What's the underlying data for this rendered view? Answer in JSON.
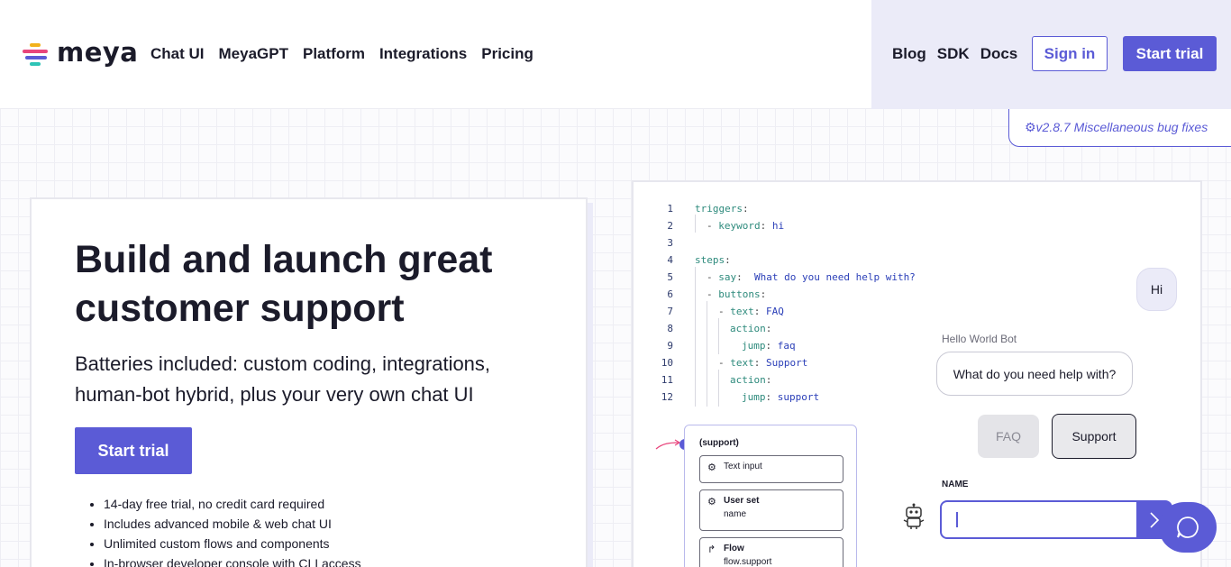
{
  "header": {
    "logo_text": "meya",
    "nav": [
      "Chat UI",
      "MeyaGPT",
      "Platform",
      "Integrations",
      "Pricing"
    ],
    "nav_right": [
      "Blog",
      "SDK",
      "Docs"
    ],
    "sign_in": "Sign in",
    "start_trial": "Start trial"
  },
  "release": {
    "text": "⚙v2.8.7 Miscellaneous bug fixes"
  },
  "hero": {
    "title": "Build and launch great customer support",
    "subtitle": "Batteries included: custom coding, integrations, human-bot hybrid, plus your very own chat UI",
    "cta": "Start trial",
    "bullets": [
      "14-day free trial, no credit card required",
      "Includes advanced mobile & web chat UI",
      "Unlimited custom flows and components",
      "In-browser developer console with CLI access"
    ]
  },
  "code": {
    "lines": [
      {
        "n": "1",
        "indent": 0,
        "parts": [
          {
            "t": "triggers",
            "c": "k"
          },
          {
            "t": ":",
            "c": "p"
          }
        ]
      },
      {
        "n": "2",
        "indent": 1,
        "parts": [
          {
            "t": "- ",
            "c": "p"
          },
          {
            "t": "keyword",
            "c": "k"
          },
          {
            "t": ": ",
            "c": "p"
          },
          {
            "t": "hi",
            "c": "v"
          }
        ]
      },
      {
        "n": "3",
        "indent": 0,
        "parts": []
      },
      {
        "n": "4",
        "indent": 0,
        "parts": [
          {
            "t": "steps",
            "c": "k"
          },
          {
            "t": ":",
            "c": "p"
          }
        ]
      },
      {
        "n": "5",
        "indent": 1,
        "parts": [
          {
            "t": "- ",
            "c": "p"
          },
          {
            "t": "say",
            "c": "k"
          },
          {
            "t": ":  ",
            "c": "p"
          },
          {
            "t": "What do you need help with?",
            "c": "v"
          }
        ]
      },
      {
        "n": "6",
        "indent": 1,
        "parts": [
          {
            "t": "- ",
            "c": "p"
          },
          {
            "t": "buttons",
            "c": "k"
          },
          {
            "t": ":",
            "c": "p"
          }
        ]
      },
      {
        "n": "7",
        "indent": 2,
        "parts": [
          {
            "t": "- ",
            "c": "p"
          },
          {
            "t": "text",
            "c": "k"
          },
          {
            "t": ": ",
            "c": "p"
          },
          {
            "t": "FAQ",
            "c": "v"
          }
        ]
      },
      {
        "n": "8",
        "indent": 3,
        "parts": [
          {
            "t": "action",
            "c": "k"
          },
          {
            "t": ":",
            "c": "p"
          }
        ]
      },
      {
        "n": "9",
        "indent": 4,
        "parts": [
          {
            "t": "jump",
            "c": "k"
          },
          {
            "t": ": ",
            "c": "p"
          },
          {
            "t": "faq",
            "c": "v"
          }
        ]
      },
      {
        "n": "10",
        "indent": 2,
        "parts": [
          {
            "t": "- ",
            "c": "p"
          },
          {
            "t": "text",
            "c": "k"
          },
          {
            "t": ": ",
            "c": "p"
          },
          {
            "t": "Support",
            "c": "v"
          }
        ]
      },
      {
        "n": "11",
        "indent": 3,
        "parts": [
          {
            "t": "action",
            "c": "k"
          },
          {
            "t": ":",
            "c": "p"
          }
        ]
      },
      {
        "n": "12",
        "indent": 4,
        "parts": [
          {
            "t": "jump",
            "c": "k"
          },
          {
            "t": ": ",
            "c": "p"
          },
          {
            "t": "support",
            "c": "v"
          }
        ]
      }
    ]
  },
  "flow": {
    "label": "(support)",
    "nodes": [
      {
        "title": "Text input",
        "detail": ""
      },
      {
        "title": "User set",
        "detail": "name"
      },
      {
        "title": "Flow",
        "detail": "flow.support"
      }
    ]
  },
  "chat": {
    "user_msg": "Hi",
    "bot_name": "Hello World Bot",
    "bot_msg": "What do you need help with?",
    "quick_replies": [
      "FAQ",
      "Support"
    ],
    "field_label": "NAME"
  },
  "colors": {
    "accent": "#5b5bd6",
    "code_key": "#2d8a7c",
    "code_value": "#2b3fb8"
  }
}
